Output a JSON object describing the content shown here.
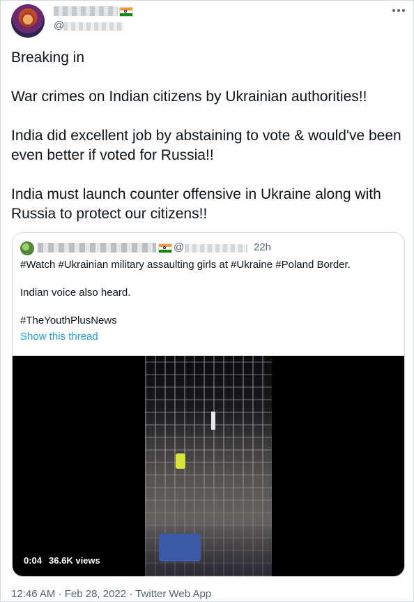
{
  "tweet": {
    "handle_prefix": "@",
    "paragraphs": [
      "Breaking in",
      "War crimes on Indian citizens by Ukrainian authorities!!",
      "India did excellent job by abstaining to vote & would've been even better if voted for Russia!!",
      "India must launch counter offensive in Ukraine along with Russia to protect our citizens!!"
    ],
    "meta": {
      "time": "12:46 AM",
      "separator": " · ",
      "date": "Feb 28, 2022",
      "source": "Twitter Web App"
    }
  },
  "quoted_tweet": {
    "handle_prefix": "@",
    "time": "22h",
    "paragraphs": [
      "#Watch #Ukrainian military assaulting girls at #Ukraine #Poland Border.",
      "Indian voice also heard.",
      "#TheYouthPlusNews"
    ],
    "show_thread_label": "Show this thread",
    "video": {
      "duration": "0:04",
      "views": "36.6K views"
    }
  },
  "icons": {
    "more": "more-horizontal-icon",
    "flag": "india-flag-icon"
  },
  "colors": {
    "link": "#1d9bf0",
    "secondary_text": "#536471",
    "border": "#cfd9de"
  }
}
